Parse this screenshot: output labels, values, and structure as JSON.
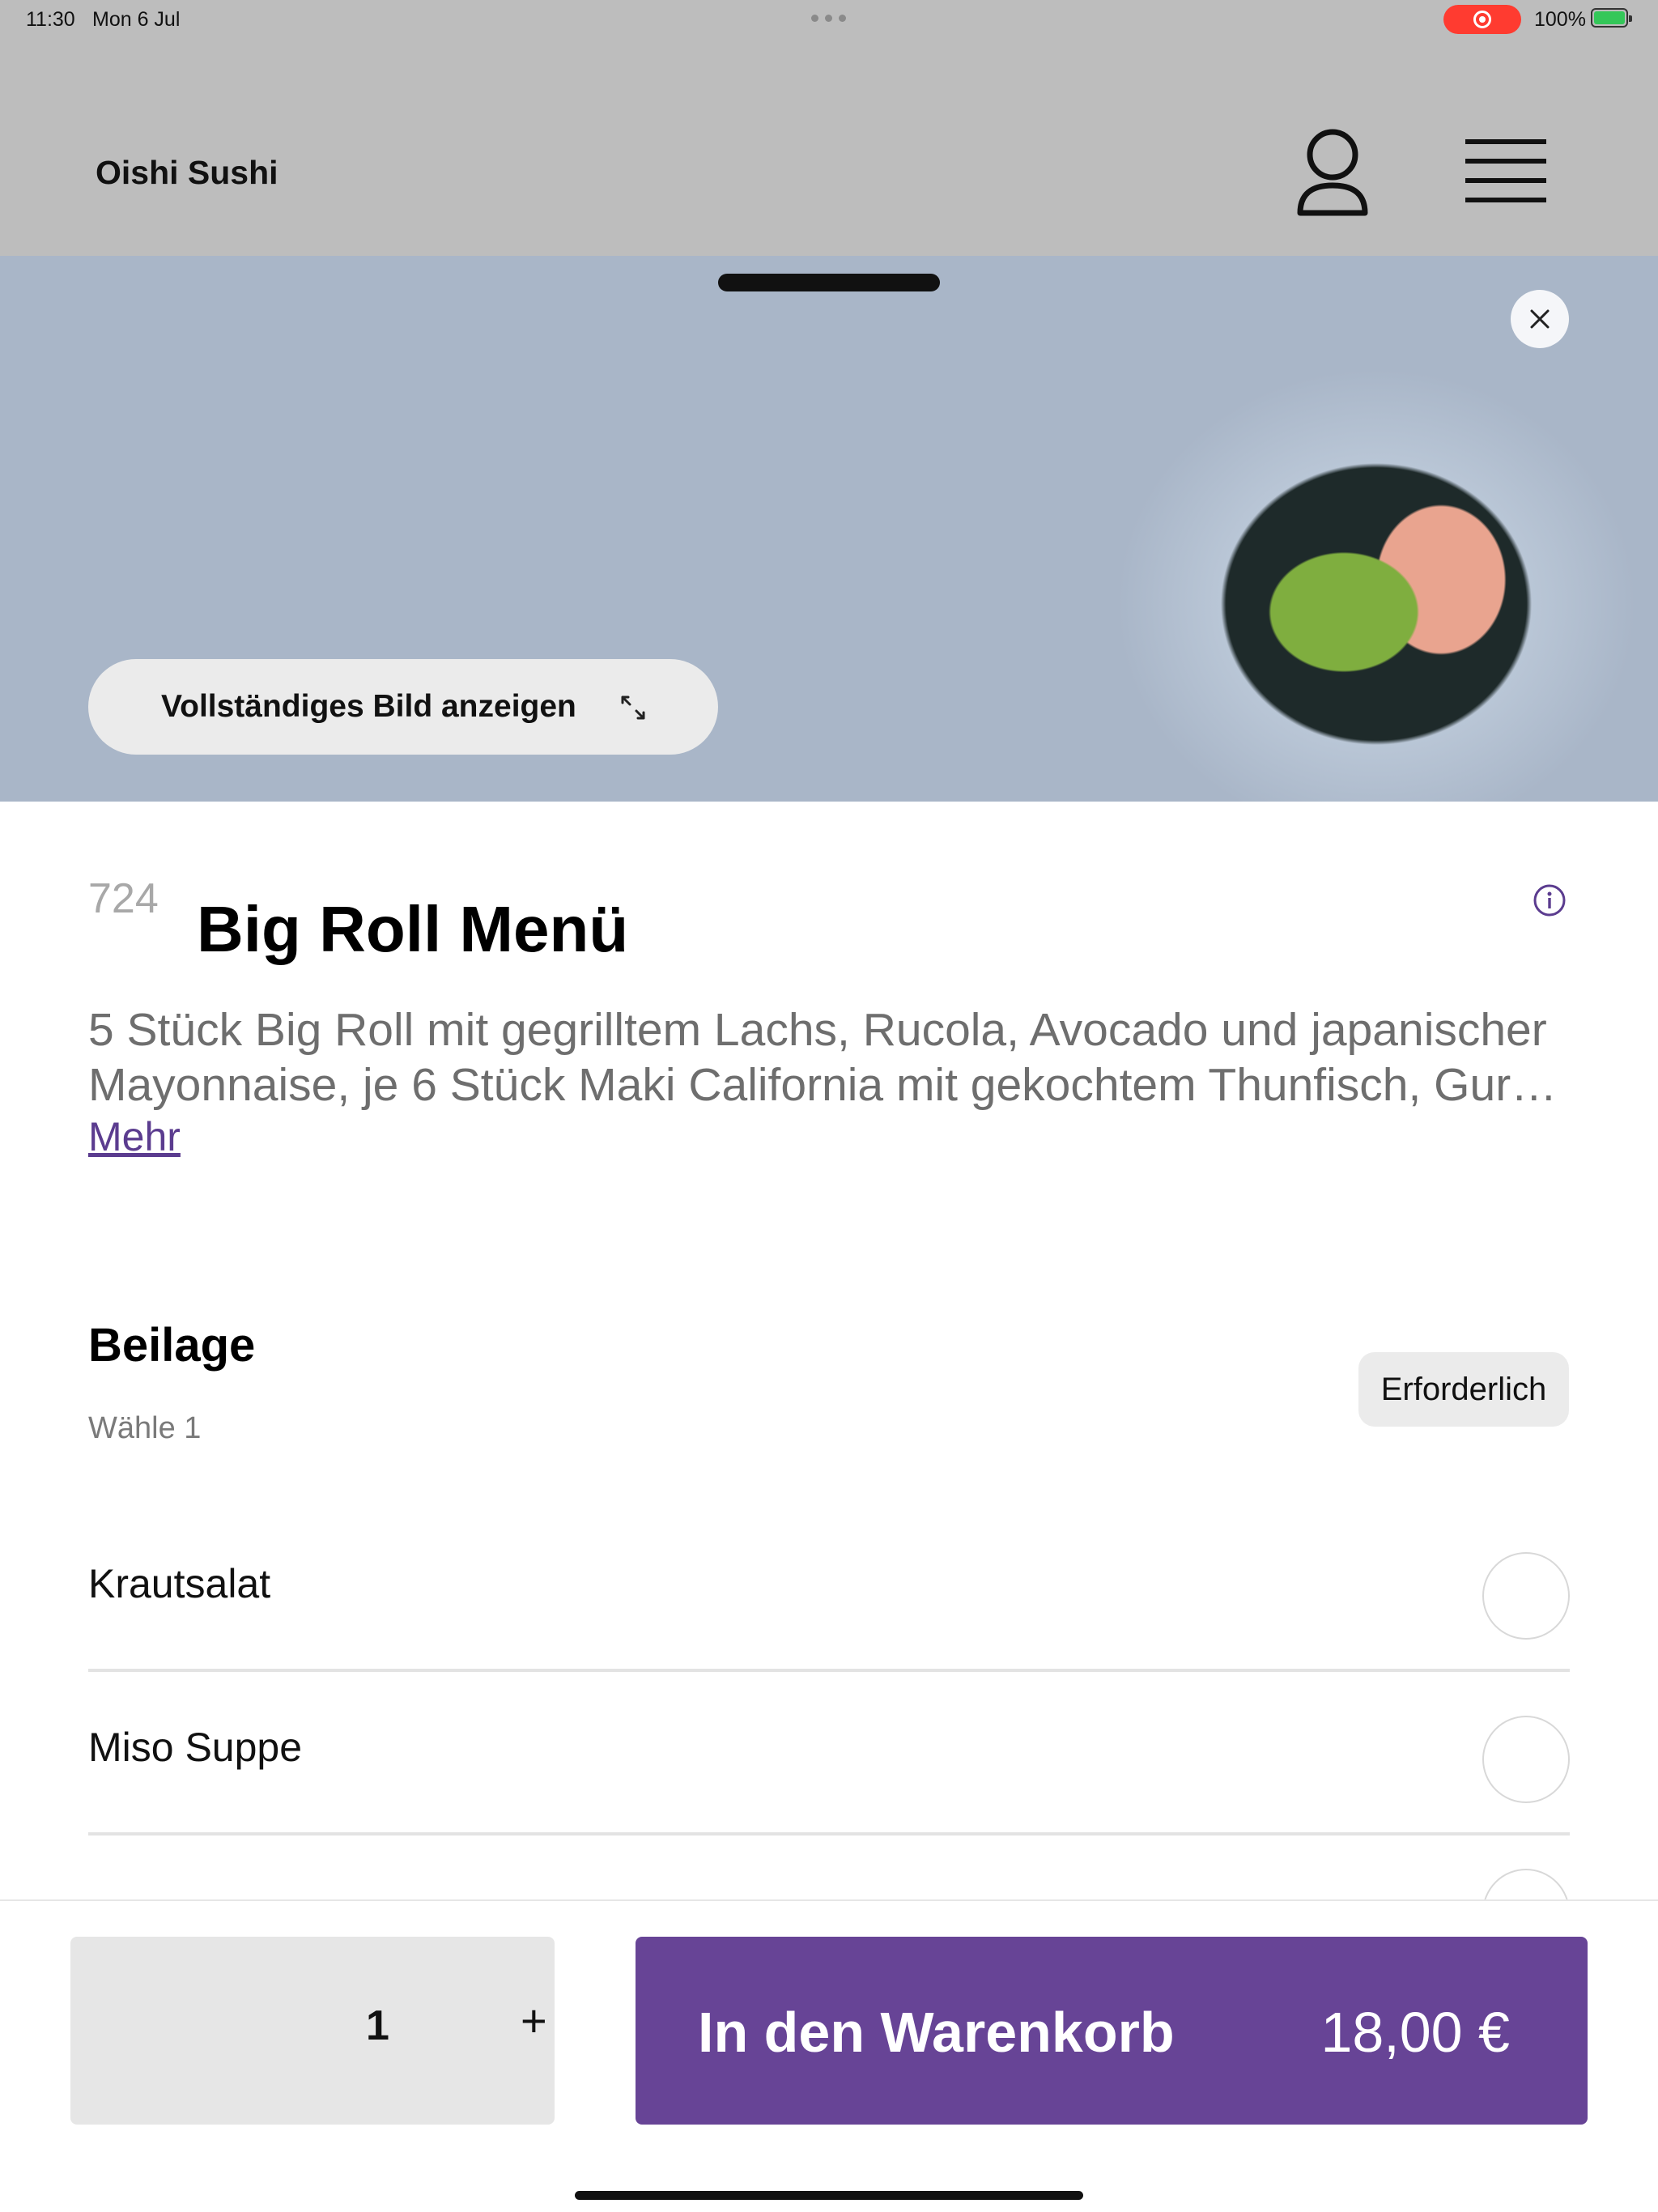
{
  "status_bar": {
    "time": "11:30",
    "date": "Mon 6 Jul",
    "battery": "100%"
  },
  "header": {
    "brand": "Oishi Sushi",
    "icons": {
      "account": "user-icon",
      "menu": "hamburger-menu-icon"
    }
  },
  "hero": {
    "show_full_image_label": "Vollständiges Bild anzeigen",
    "icons": {
      "close": "close-icon",
      "expand": "expand-icon"
    }
  },
  "item": {
    "number": "724",
    "title": "Big Roll Menü",
    "description_line1": "5 Stück Big Roll mit gegrilltem Lachs, Rucola, Avocado und japanischer",
    "description_line2": "Mayonnaise, je 6 Stück Maki California mit gekochtem Thunfisch, Gurk...",
    "more_label": "Mehr"
  },
  "option_group": {
    "title": "Beilage",
    "subtitle": "Wähle 1",
    "badge": "Erforderlich",
    "options": [
      {
        "label": "Krautsalat"
      },
      {
        "label": "Miso Suppe"
      }
    ]
  },
  "footer": {
    "quantity": "1",
    "plus_label": "+",
    "add_to_cart_label": "In den Warenkorb",
    "price": "18,00 €"
  },
  "colors": {
    "accent": "#674496",
    "link": "#5b3c8f",
    "header_bg": "#bdbdbd",
    "badge_bg": "#ebebeb"
  }
}
